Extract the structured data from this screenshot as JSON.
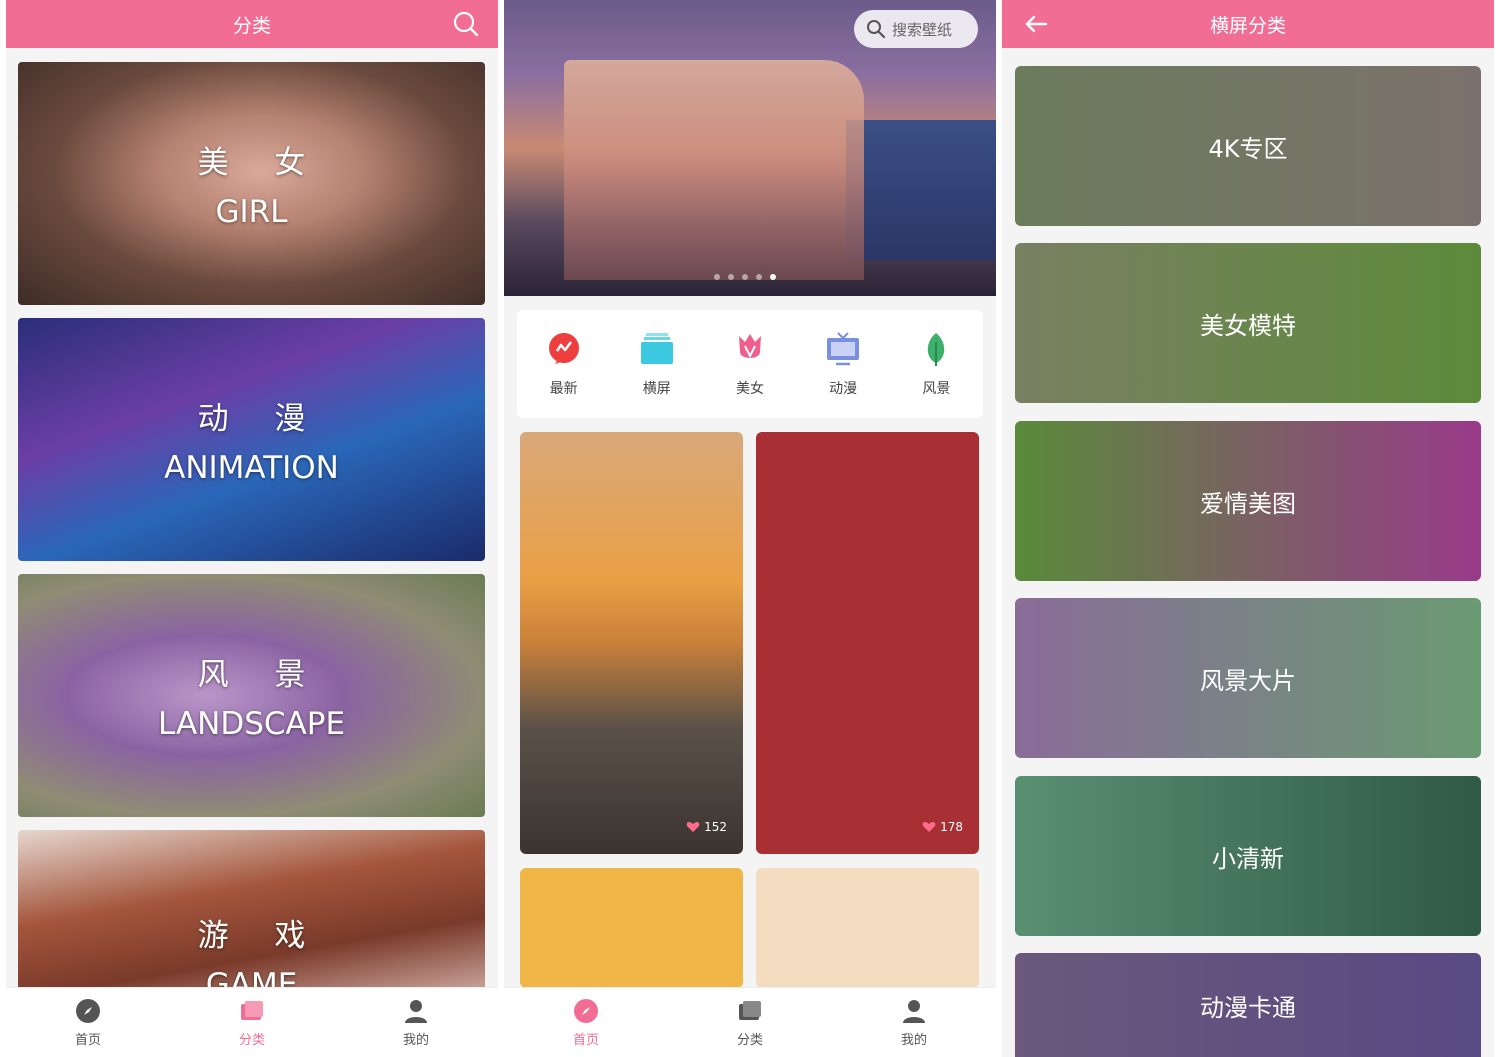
{
  "screen1": {
    "title": "分类",
    "cards": [
      {
        "cn": "美 女",
        "en": "GIRL"
      },
      {
        "cn": "动 漫",
        "en": "ANIMATION"
      },
      {
        "cn": "风 景",
        "en": "LANDSCAPE"
      },
      {
        "cn": "游 戏",
        "en": "GAME"
      }
    ],
    "nav": [
      {
        "label": "首页",
        "icon": "compass-icon"
      },
      {
        "label": "分类",
        "icon": "category-icon"
      },
      {
        "label": "我的",
        "icon": "user-icon"
      }
    ]
  },
  "screen2": {
    "search_label": "搜索壁纸",
    "quick": [
      {
        "label": "最新",
        "icon": "new-icon",
        "color": "#ef3e3e"
      },
      {
        "label": "横屏",
        "icon": "landscape-icon",
        "color": "#3cc8e0"
      },
      {
        "label": "美女",
        "icon": "tulip-icon",
        "color": "#ef5f8e"
      },
      {
        "label": "动漫",
        "icon": "tv-icon",
        "color": "#7a8fe0"
      },
      {
        "label": "风景",
        "icon": "leaf-icon",
        "color": "#3fb06b"
      }
    ],
    "tiles": [
      {
        "likes": "152"
      },
      {
        "likes": "178"
      }
    ],
    "nav": [
      {
        "label": "首页",
        "icon": "compass-icon"
      },
      {
        "label": "分类",
        "icon": "category-icon"
      },
      {
        "label": "我的",
        "icon": "user-icon"
      }
    ]
  },
  "screen3": {
    "title": "横屏分类",
    "categories": [
      "4K专区",
      "美女模特",
      "爱情美图",
      "风景大片",
      "小清新",
      "动漫卡通"
    ]
  },
  "colors": {
    "accent": "#f26d93"
  }
}
